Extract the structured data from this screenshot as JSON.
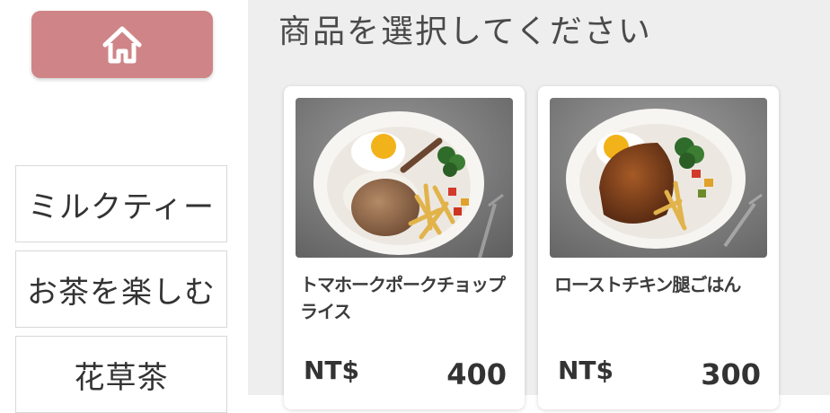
{
  "sidebar": {
    "categories": [
      {
        "label": "ミルクティー"
      },
      {
        "label": "お茶を楽しむ"
      },
      {
        "label": "花草茶"
      }
    ]
  },
  "main": {
    "title": "商品を選択してください",
    "products": [
      {
        "name": "トマホークポークチョップライス",
        "currency": "NT$",
        "price": "400"
      },
      {
        "name": "ローストチキン腿ごはん",
        "currency": "NT$",
        "price": "300"
      }
    ]
  },
  "colors": {
    "accent": "#cf8587",
    "panel_bg": "#eeeeee"
  },
  "icons": {
    "home": "home-icon"
  }
}
